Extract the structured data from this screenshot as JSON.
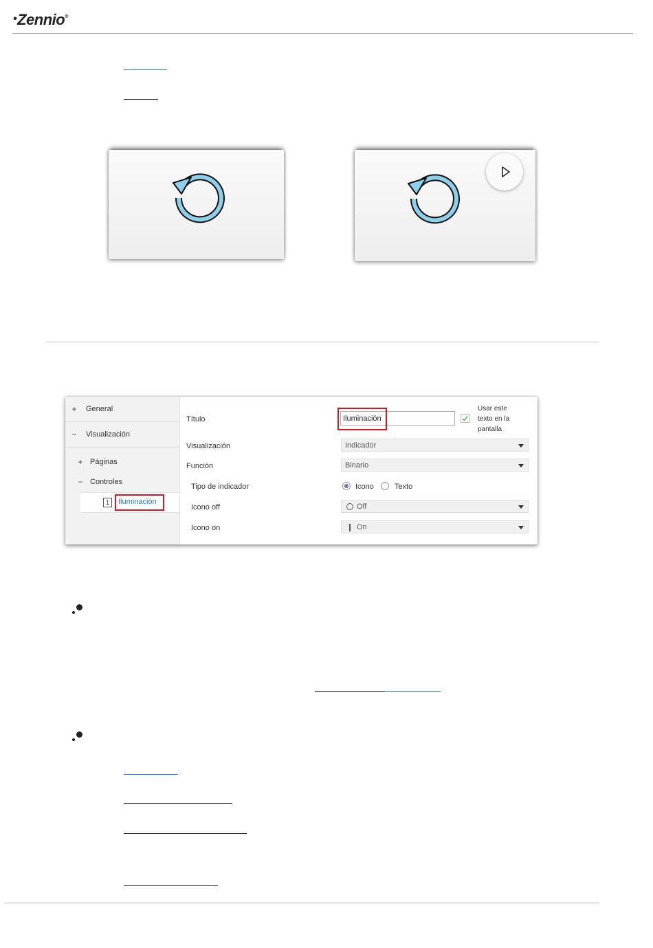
{
  "header": {
    "logo_text": "Zennio",
    "logo_dot": "•",
    "logo_reg": "®"
  },
  "colors": {
    "link_blue": "#1f7fc4",
    "underline_dark": "#222222",
    "redbox": "#e0141e",
    "icon_blue": "#8ecfea"
  },
  "ets": {
    "sidebar": {
      "general": "General",
      "visualizacion": "Visualización",
      "paginas": "Páginas",
      "controles": "Controles",
      "item_number": "1",
      "item_label": "Iluminación"
    },
    "sign_plus": "+",
    "sign_minus": "−",
    "form": {
      "titulo_label": "Título",
      "titulo_value": "Iluminación",
      "usar_texto": [
        "Usar este",
        "texto en la",
        "pantalla"
      ],
      "visualizacion_label": "Visualización",
      "visualizacion_value": "Indicador",
      "funcion_label": "Función",
      "funcion_value": "Binario",
      "tipo_label": "Tipo de indicador",
      "radio_icono": "Icono",
      "radio_texto": "Texto",
      "icono_off_label": "Icono off",
      "icono_off_value": "Off",
      "icono_on_label": "Icono on",
      "icono_on_value": "On"
    }
  }
}
